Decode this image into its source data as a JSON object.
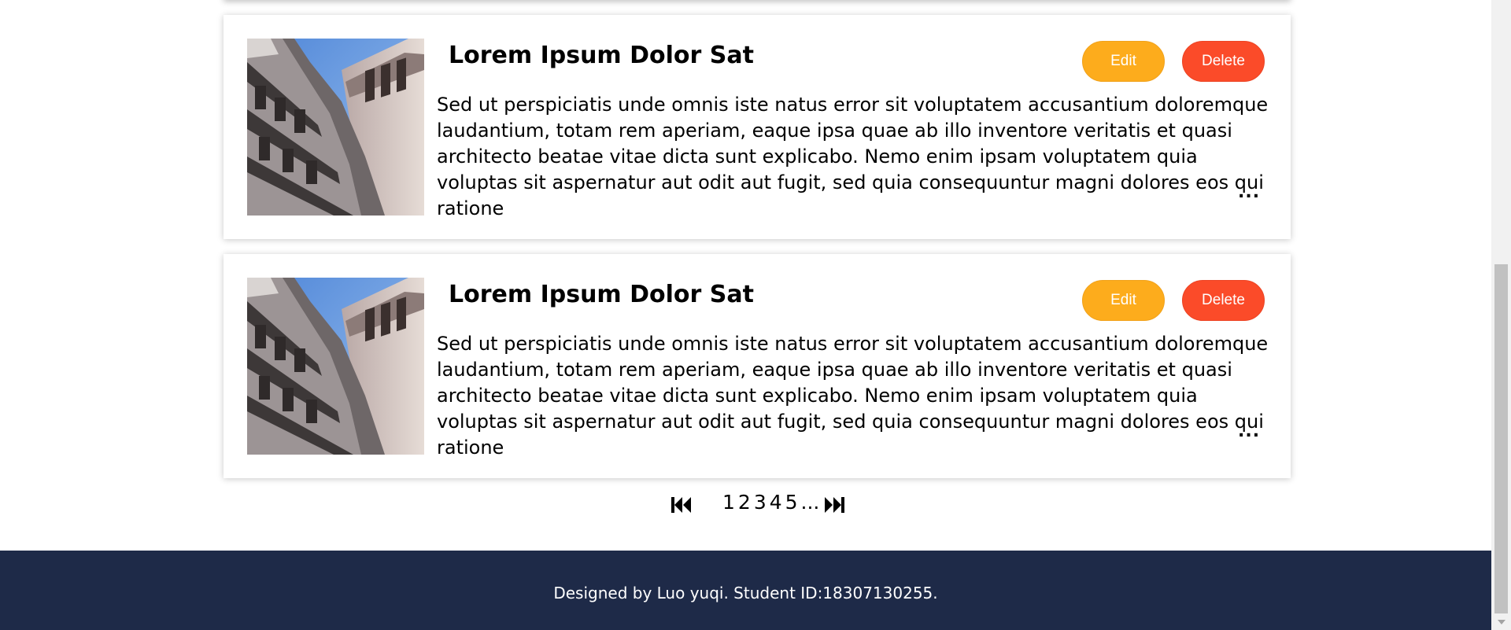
{
  "cards": [
    {
      "title": "Lorem Ipsum Dolor Sat",
      "edit_label": "Edit",
      "delete_label": "Delete",
      "body": "Sed ut perspiciatis unde omnis iste natus error sit voluptatem accusantium doloremque laudantium, totam rem aperiam, eaque ipsa quae ab illo inventore veritatis et quasi architecto beatae vitae dicta sunt explicabo. Nemo enim ipsam voluptatem quia voluptas sit aspernatur aut odit aut fugit, sed quia consequuntur magni dolores eos qui ratione",
      "more": "...",
      "image": "cathedral-photo"
    },
    {
      "title": "Lorem Ipsum Dolor Sat",
      "edit_label": "Edit",
      "delete_label": "Delete",
      "body": "Sed ut perspiciatis unde omnis iste natus error sit voluptatem accusantium doloremque laudantium, totam rem aperiam, eaque ipsa quae ab illo inventore veritatis et quasi architecto beatae vitae dicta sunt explicabo. Nemo enim ipsam voluptatem quia voluptas sit aspernatur aut odit aut fugit, sed quia consequuntur magni dolores eos qui ratione",
      "more": "...",
      "image": "cathedral-photo"
    }
  ],
  "pagination": {
    "first_icon": "first-page-icon",
    "pages": [
      "1",
      "2",
      "3",
      "4",
      "5"
    ],
    "more": "...",
    "last_icon": "last-page-icon"
  },
  "footer": {
    "text": "Designed by Luo yuqi. Student ID:18307130255."
  },
  "colors": {
    "edit": "#fdac1c",
    "delete": "#fb4b29",
    "footer_bg": "#1e2a48"
  }
}
